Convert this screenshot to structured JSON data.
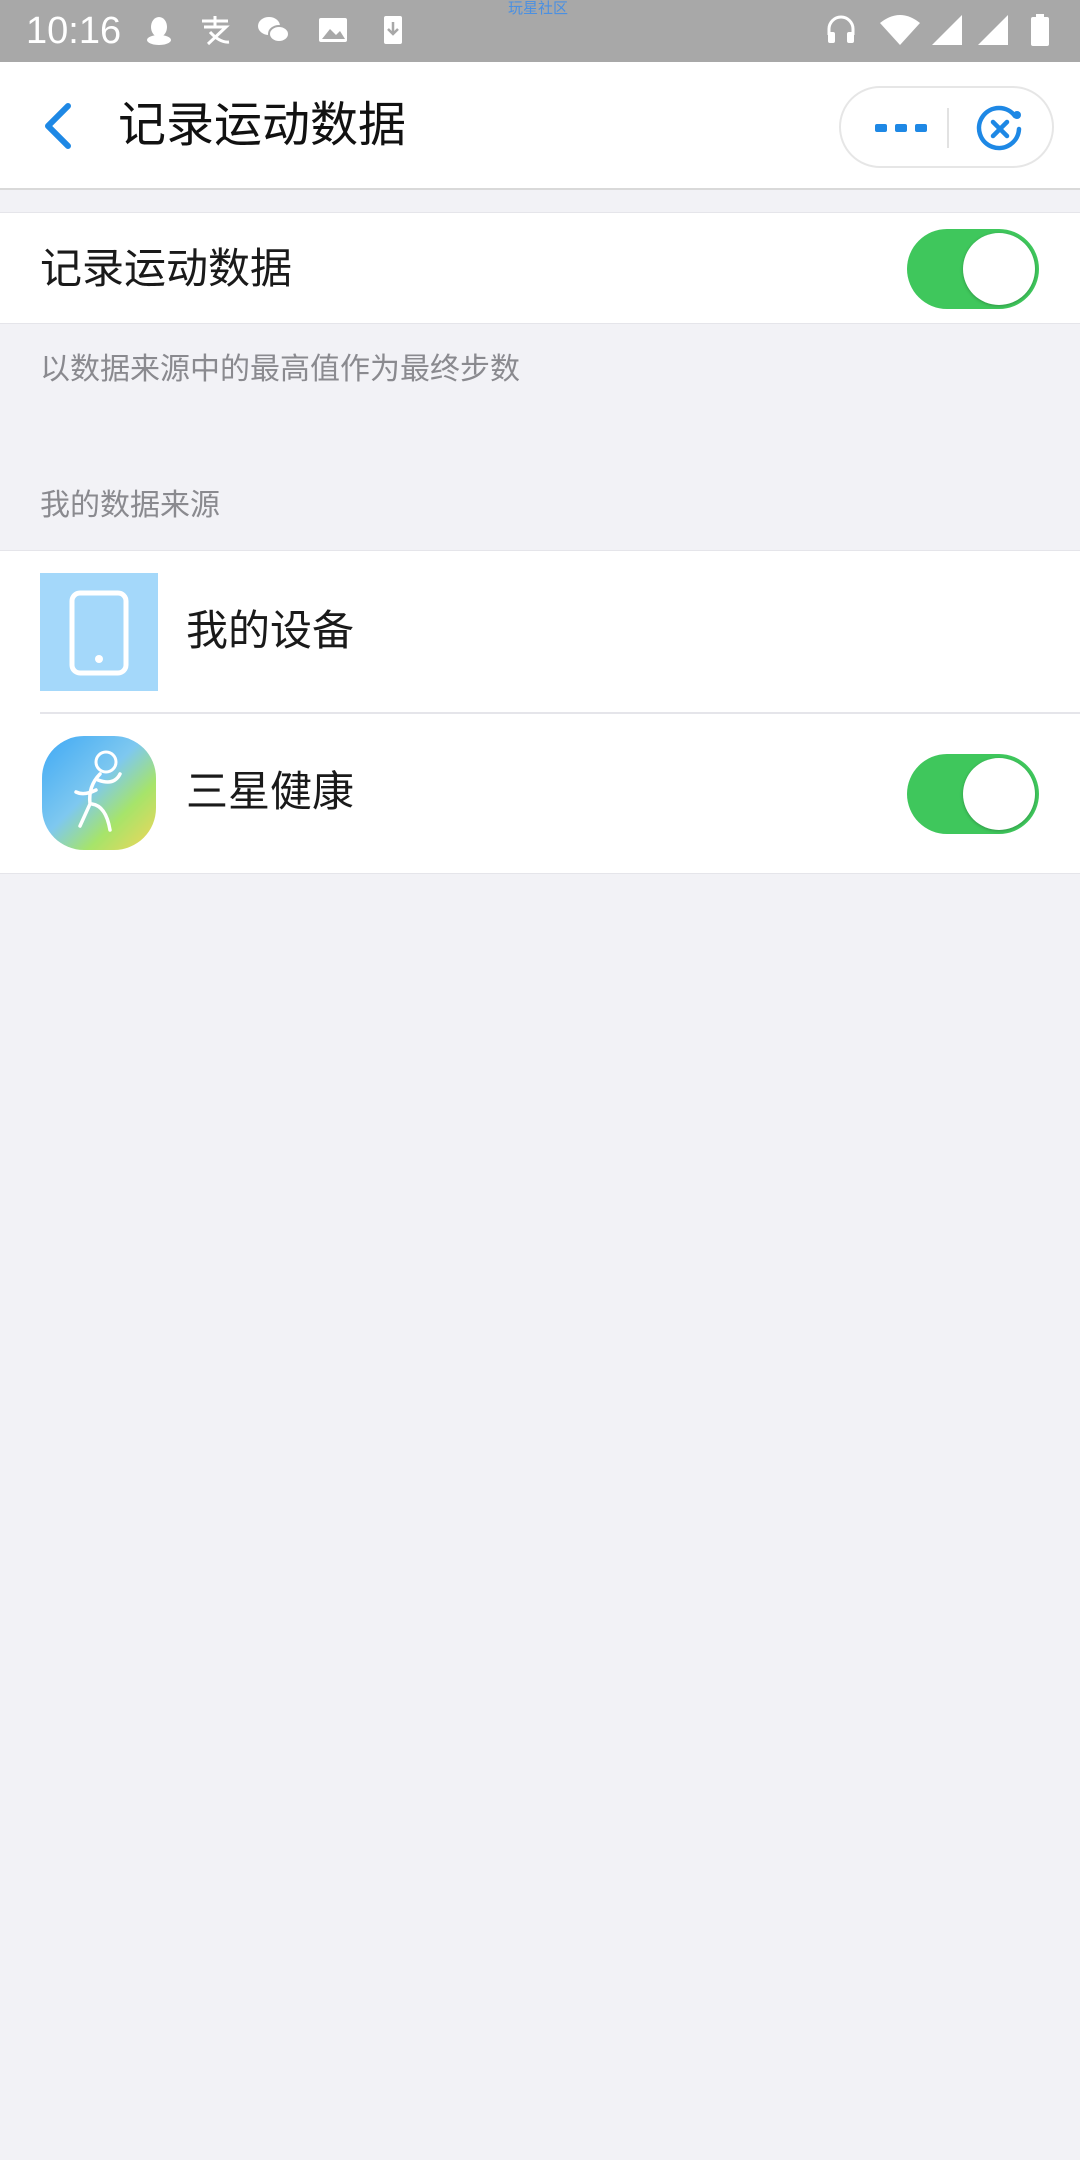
{
  "status_bar": {
    "time": "10:16",
    "watermark": "玩星社区",
    "icons": [
      "qq-icon",
      "alipay-icon",
      "wechat-icon",
      "gallery-icon",
      "download-icon",
      "headset-icon",
      "wifi-icon",
      "signal-icon",
      "signal-icon",
      "battery-icon"
    ]
  },
  "nav": {
    "title": "记录运动数据",
    "back_icon": "chevron-left-icon",
    "more_icon": "more-dots-icon",
    "close_icon": "close-circle-icon"
  },
  "record": {
    "label": "记录运动数据",
    "toggle_on": true
  },
  "hint": "以数据来源中的最高值作为最终步数",
  "sources": {
    "header": "我的数据来源",
    "items": [
      {
        "label": "我的设备",
        "icon": "phone-device-icon"
      },
      {
        "label": "三星健康",
        "icon": "samsung-health-icon",
        "toggle_on": true
      }
    ]
  },
  "colors": {
    "accent": "#1e88e5",
    "toggle_on": "#3fc75c",
    "background": "#f2f2f6",
    "status_bar": "#a8a8a8"
  }
}
